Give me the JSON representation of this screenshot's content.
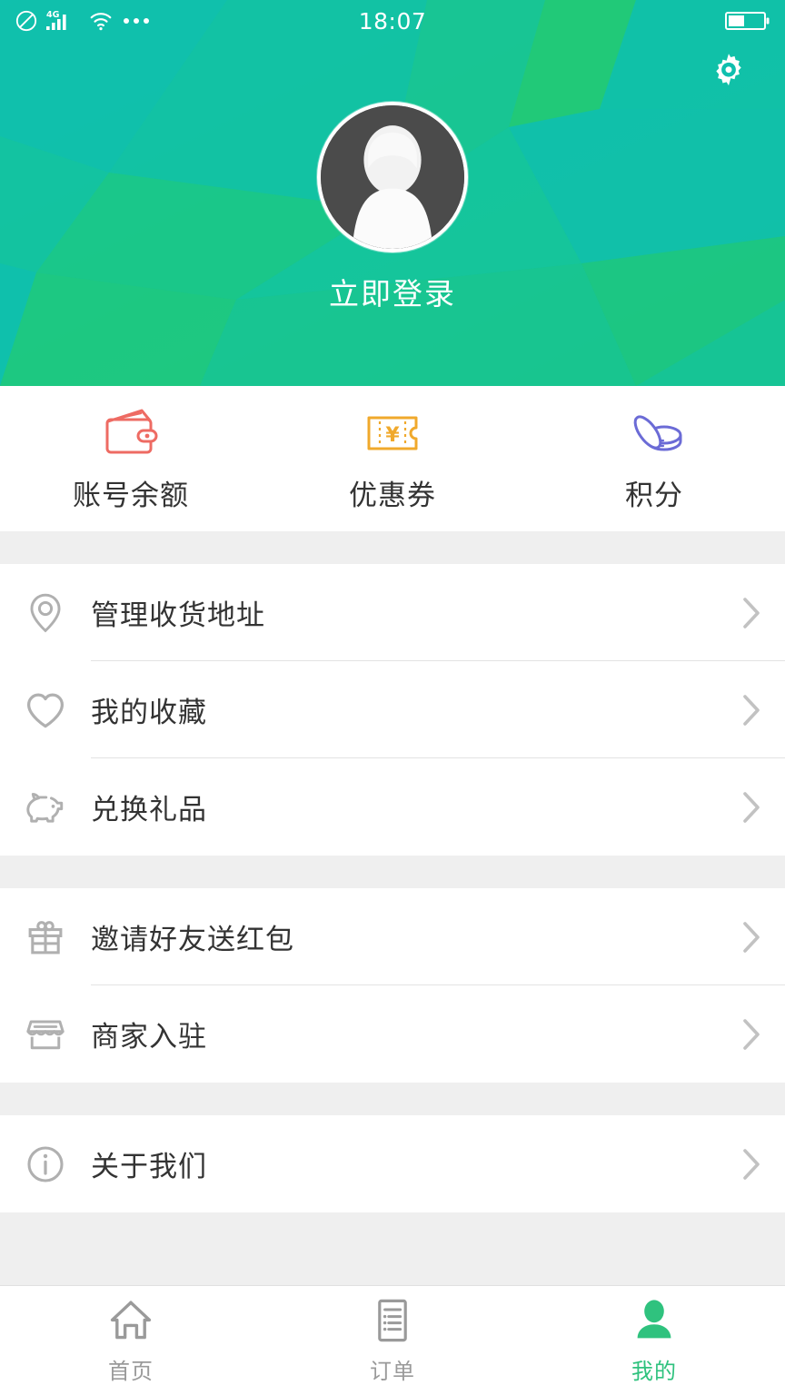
{
  "statusbar": {
    "time": "18:07",
    "network_label": "4G",
    "icons": [
      "do-not-disturb-icon",
      "signal-icon",
      "wifi-icon",
      "more-icon",
      "battery-icon"
    ]
  },
  "header": {
    "settings_icon": "gear-icon",
    "avatar_icon": "default-avatar-icon",
    "login_label": "立即登录",
    "bg_color_teal": "#0EBFAE",
    "bg_color_green": "#1FC77C"
  },
  "quick_actions": [
    {
      "label": "账号余额",
      "icon": "wallet-icon",
      "color": "#EE6B63"
    },
    {
      "label": "优惠券",
      "icon": "coupon-icon",
      "color": "#F0A92C"
    },
    {
      "label": "积分",
      "icon": "coins-icon",
      "color": "#6B6BD6"
    }
  ],
  "menu_groups": [
    {
      "items": [
        {
          "label": "管理收货地址",
          "icon": "location-pin-icon"
        },
        {
          "label": "我的收藏",
          "icon": "heart-icon"
        },
        {
          "label": "兑换礼品",
          "icon": "piggy-bank-icon"
        }
      ]
    },
    {
      "items": [
        {
          "label": "邀请好友送红包",
          "icon": "gift-icon"
        },
        {
          "label": "商家入驻",
          "icon": "store-icon"
        }
      ]
    },
    {
      "items": [
        {
          "label": "关于我们",
          "icon": "info-circle-icon"
        }
      ]
    }
  ],
  "tabbar": {
    "active_color": "#2FC27E",
    "inactive_color": "#9A9A9A",
    "tabs": [
      {
        "label": "首页",
        "icon": "home-icon",
        "active": false
      },
      {
        "label": "订单",
        "icon": "order-list-icon",
        "active": false
      },
      {
        "label": "我的",
        "icon": "person-icon",
        "active": true
      }
    ]
  }
}
